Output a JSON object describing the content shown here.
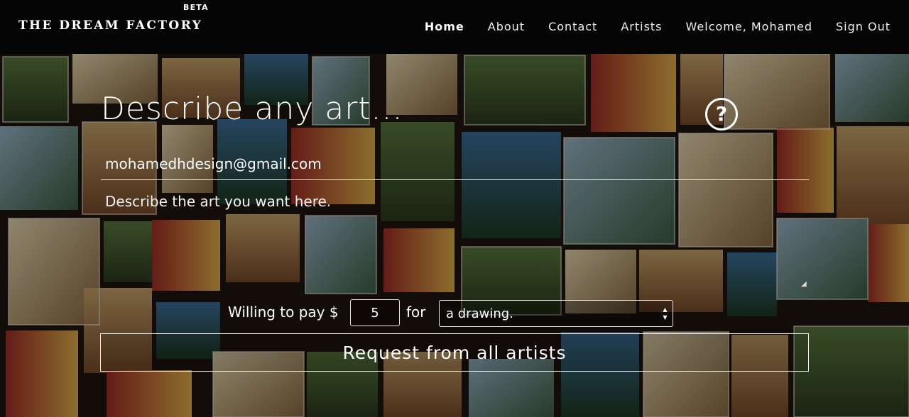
{
  "navbar": {
    "brand": "THE DREAM FACTORY",
    "beta": "BETA",
    "items": [
      {
        "label": "Home",
        "active": true
      },
      {
        "label": "About"
      },
      {
        "label": "Contact"
      },
      {
        "label": "Artists"
      },
      {
        "label": "Welcome, Mohamed"
      },
      {
        "label": "Sign Out"
      }
    ]
  },
  "form": {
    "title": "Describe any art...",
    "help_icon": "question-circle-icon",
    "email": "mohamedhdesign@gmail.com",
    "description_placeholder": "Describe the art you want here.",
    "pay_label": "Willing to pay $",
    "price": "5",
    "for_label": "for",
    "kind_selected": "a drawing.",
    "submit_label": "Request from all artists"
  },
  "colors": {
    "navbar_bg": "#050505",
    "text": "#ffffff"
  }
}
